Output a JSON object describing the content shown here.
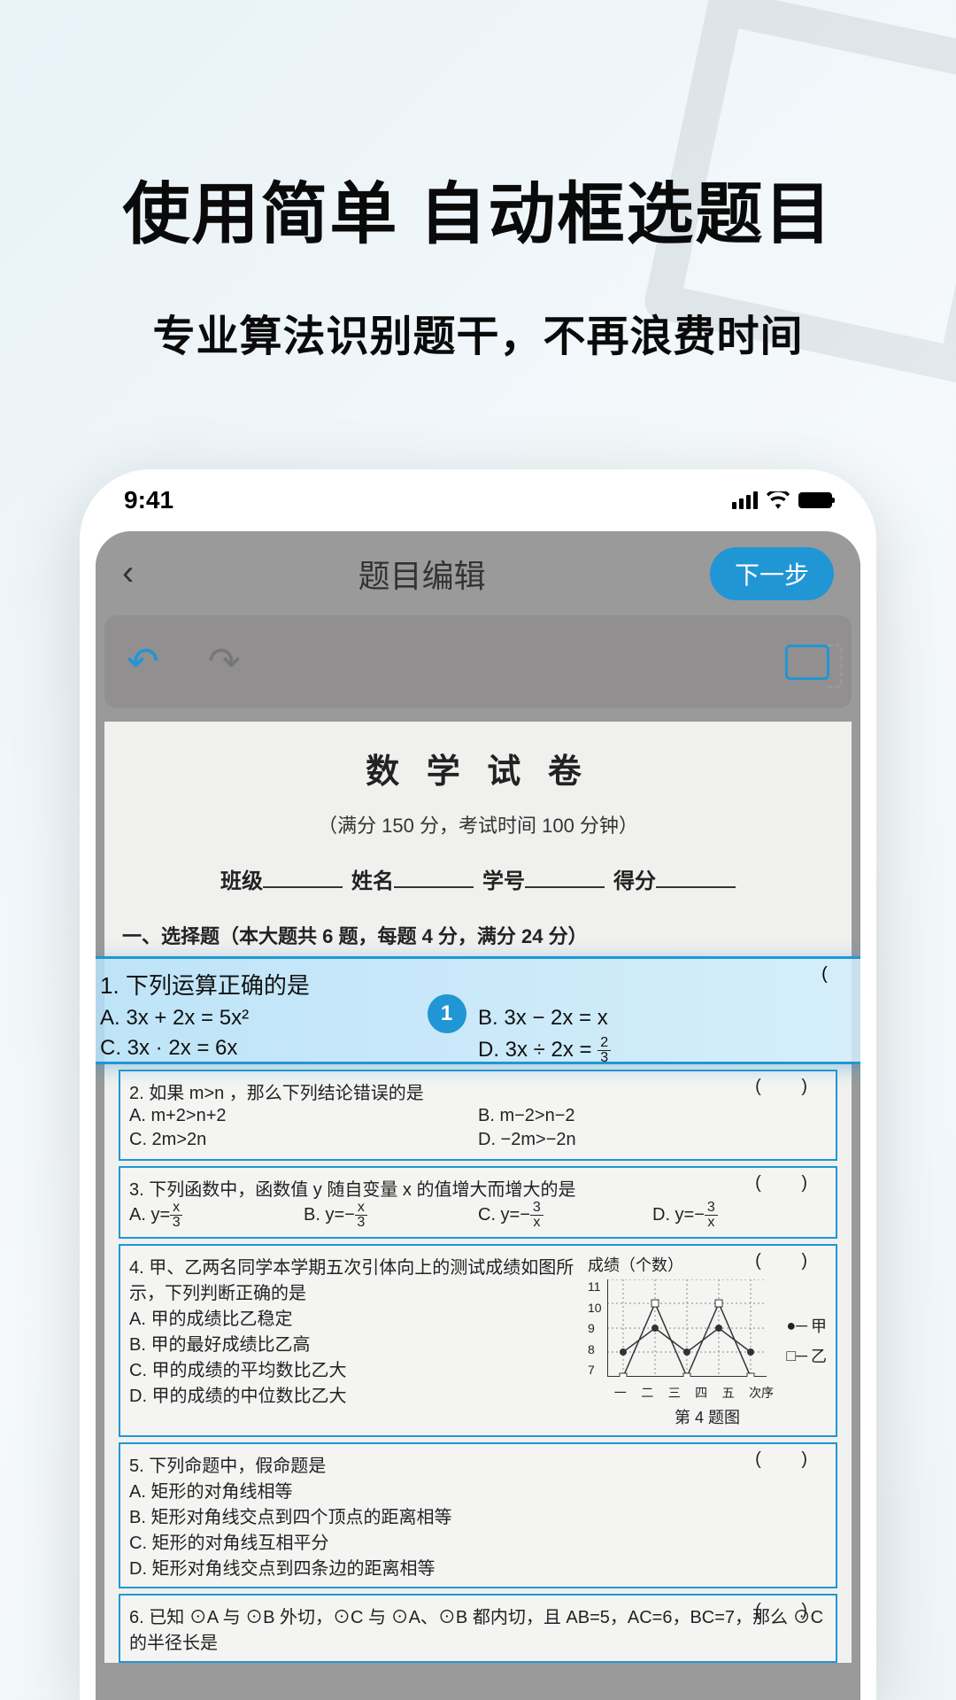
{
  "promo": {
    "headline": "使用简单 自动框选题目",
    "subline": "专业算法识别题干，不再浪费时间"
  },
  "status": {
    "time": "9:41"
  },
  "app": {
    "header_title": "题目编辑",
    "next_label": "下一步",
    "back_icon": "‹"
  },
  "document": {
    "title": "数 学 试 卷",
    "subtitle": "（满分 150 分，考试时间 100 分钟）",
    "fields": {
      "class": "班级",
      "name": "姓名",
      "id": "学号",
      "score": "得分"
    },
    "section1": "一、选择题（本大题共 6 题，每题 4 分，满分 24 分）",
    "highlight_badge": "1",
    "q1": {
      "stem": "1. 下列运算正确的是",
      "A": "A. 3x + 2x = 5x²",
      "B": "B. 3x − 2x = x",
      "C": "C. 3x · 2x = 6x",
      "D": "D. 3x ÷ 2x = 2⁄3"
    },
    "q2": {
      "stem": "2. 如果 m>n ，那么下列结论错误的是",
      "A": "A. m+2>n+2",
      "B": "B. m−2>n−2",
      "C": "C. 2m>2n",
      "D": "D. −2m>−2n"
    },
    "q3": {
      "stem": "3. 下列函数中，函数值 y 随自变量 x 的值增大而增大的是",
      "A": "A. y = x⁄3",
      "B": "B. y = − x⁄3",
      "C": "C. y = − 3⁄x",
      "D": "D. y = − 3⁄x"
    },
    "q4": {
      "stem": "4. 甲、乙两名同学本学期五次引体向上的测试成绩如图所示，下列判断正确的是",
      "A": "A. 甲的成绩比乙稳定",
      "B": "B. 甲的最好成绩比乙高",
      "C": "C. 甲的成绩的平均数比乙大",
      "D": "D. 甲的成绩的中位数比乙大",
      "chart_label": "成绩（个数）",
      "chart_legend_a": "甲",
      "chart_legend_b": "乙",
      "chart_caption": "第 4 题图",
      "axis_label": "次序",
      "axis_ticks": [
        "一",
        "二",
        "三",
        "四",
        "五"
      ]
    },
    "q5": {
      "stem": "5. 下列命题中，假命题是",
      "A": "A. 矩形的对角线相等",
      "B": "B. 矩形对角线交点到四个顶点的距离相等",
      "C": "C. 矩形的对角线互相平分",
      "D": "D. 矩形对角线交点到四条边的距离相等"
    },
    "q6": {
      "stem": "6. 已知 ⊙A 与 ⊙B 外切，⊙C 与 ⊙A、⊙B 都内切，且 AB=5，AC=6，BC=7，那么 ⊙C 的半径长是"
    }
  },
  "chart_data": {
    "type": "line",
    "title": "成绩（个数）",
    "xlabel": "次序",
    "ylabel": "成绩（个数）",
    "x_ticks": [
      "一",
      "二",
      "三",
      "四",
      "五"
    ],
    "y_ticks": [
      7,
      8,
      9,
      10,
      11
    ],
    "ylim": [
      7,
      11
    ],
    "series": [
      {
        "name": "甲",
        "marker": "filled-circle",
        "values": [
          8,
          9,
          8,
          9,
          8
        ]
      },
      {
        "name": "乙",
        "marker": "open-square",
        "values": [
          7,
          10,
          7,
          10,
          7
        ]
      }
    ]
  }
}
